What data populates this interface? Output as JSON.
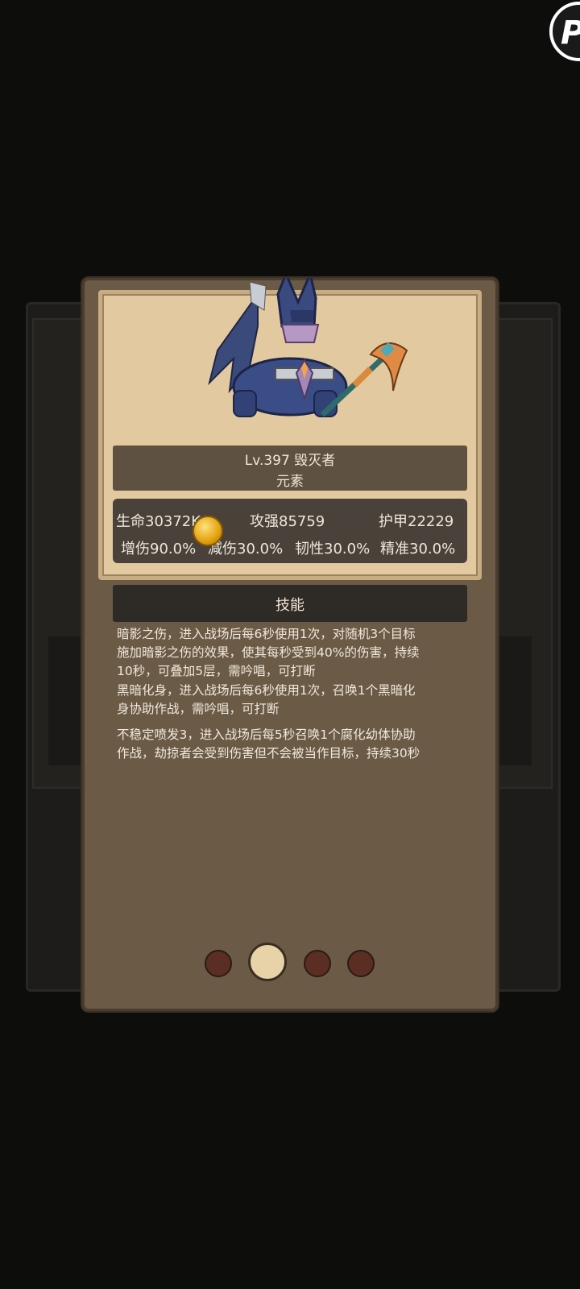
{
  "corner_button": {
    "glyph": "P"
  },
  "monster": {
    "level": "Lv.397",
    "name": "毁灭者",
    "element": "元素"
  },
  "stats": {
    "hp": "生命30372K",
    "attack": "攻强85759",
    "armor": "护甲22229",
    "dmg_increase": "增伤90.0%",
    "dmg_reduction": "减伤30.0%",
    "toughness": "韧性30.0%",
    "precision": "精准30.0%"
  },
  "skills": {
    "header": "技能",
    "items": [
      {
        "lines": [
          "暗影之伤，进入战场后每6秒使用1次，对随机3个目标",
          "施加暗影之伤的效果，使其每秒受到40%的伤害，持续",
          "10秒，可叠加5层，需吟唱，可打断"
        ]
      },
      {
        "lines": [
          "黑暗化身，进入战场后每6秒使用1次，召唤1个黑暗化",
          "身协助作战，需吟唱，可打断"
        ]
      },
      {
        "lines": [
          "不稳定喷发3，进入战场后每5秒召唤1个腐化幼体协助",
          "作战，劫掠者会受到伤害但不会被当作目标，持续30秒"
        ]
      }
    ]
  },
  "pagination": {
    "total": 4,
    "active": 2
  },
  "colors": {
    "dialog": "#6b5b46",
    "card": "#e2c99f",
    "active_dot": "#e8d3a9",
    "inactive_dot": "#5a2e22"
  }
}
